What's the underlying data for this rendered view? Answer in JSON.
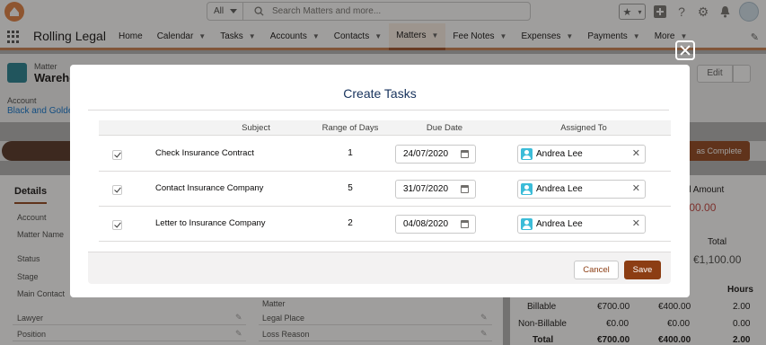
{
  "colors": {
    "brand": "#8c3d13",
    "nav_active_bg": "#fbeee4",
    "modal_title": "#16325c",
    "user_icon": "#3bbcd8"
  },
  "global_header": {
    "search_scope": "All",
    "search_placeholder": "Search Matters and more...",
    "icons": [
      "favorites-star-icon",
      "add-icon",
      "help-icon",
      "setup-gear-icon",
      "notifications-bell-icon",
      "user-avatar"
    ]
  },
  "nav": {
    "app_name": "Rolling Legal",
    "items": [
      {
        "label": "Home",
        "has_menu": false
      },
      {
        "label": "Calendar",
        "has_menu": true
      },
      {
        "label": "Tasks",
        "has_menu": true
      },
      {
        "label": "Accounts",
        "has_menu": true
      },
      {
        "label": "Contacts",
        "has_menu": true
      },
      {
        "label": "Matters",
        "has_menu": true,
        "active": true
      },
      {
        "label": "Fee Notes",
        "has_menu": true
      },
      {
        "label": "Expenses",
        "has_menu": true
      },
      {
        "label": "Payments",
        "has_menu": true
      },
      {
        "label": "More",
        "has_menu": true
      }
    ]
  },
  "record": {
    "object_label": "Matter",
    "title_visible": "Wareho",
    "account_label": "Account",
    "account_value": "Black and Golde",
    "edit_label": "Edit",
    "mark_complete_label": "as Complete"
  },
  "details": {
    "tab_label": "Details",
    "left_fields": [
      "Account",
      "Matter Name",
      "Status",
      "Stage",
      "Main Contact",
      "Lawyer",
      "Position"
    ],
    "right_fields": [
      "Matter",
      "Legal Place",
      "Loss Reason"
    ]
  },
  "summary": {
    "amount_header": "d Amount",
    "amount_value": ".00.00",
    "total_header": "Total",
    "total_value": "€1,100.00",
    "hours_header": "Hours",
    "rows": [
      {
        "label": "Billable",
        "a": "€700.00",
        "b": "€400.00",
        "hours": "2.00"
      },
      {
        "label": "Non-Billable",
        "a": "€0.00",
        "b": "€0.00",
        "hours": "0.00"
      },
      {
        "label": "Total",
        "a": "€700.00",
        "b": "€400.00",
        "hours": "2.00"
      }
    ]
  },
  "modal": {
    "title": "Create Tasks",
    "columns": {
      "subject": "Subject",
      "range_of_days": "Range of Days",
      "due_date": "Due Date",
      "assigned_to": "Assigned To"
    },
    "rows": [
      {
        "checked": true,
        "subject": "Check Insurance Contract",
        "days": "1",
        "due_date": "24/07/2020",
        "assigned_to": "Andrea Lee"
      },
      {
        "checked": true,
        "subject": "Contact Insurance Company",
        "days": "5",
        "due_date": "31/07/2020",
        "assigned_to": "Andrea Lee"
      },
      {
        "checked": true,
        "subject": "Letter to Insurance Company",
        "days": "2",
        "due_date": "04/08/2020",
        "assigned_to": "Andrea Lee"
      }
    ],
    "cancel_label": "Cancel",
    "save_label": "Save"
  }
}
